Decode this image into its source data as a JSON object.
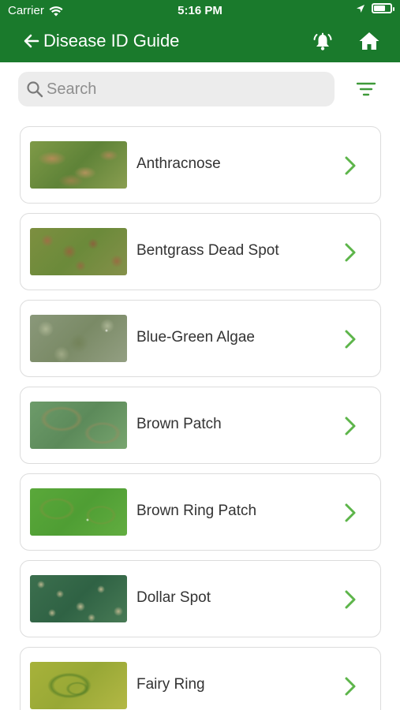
{
  "status_bar": {
    "carrier": "Carrier",
    "time": "5:16 PM"
  },
  "header": {
    "title": "Disease ID Guide"
  },
  "search": {
    "placeholder": "Search",
    "value": ""
  },
  "colors": {
    "brand_green": "#1a7a2c",
    "chevron_green": "#5db54a"
  },
  "diseases": [
    {
      "name": "Anthracnose",
      "thumbnail": "turf-anthracnose-photo"
    },
    {
      "name": "Bentgrass Dead Spot",
      "thumbnail": "turf-bentgrass-dead-spot-photo"
    },
    {
      "name": "Blue-Green Algae",
      "thumbnail": "turf-blue-green-algae-photo"
    },
    {
      "name": "Brown Patch",
      "thumbnail": "turf-brown-patch-photo"
    },
    {
      "name": "Brown Ring Patch",
      "thumbnail": "turf-brown-ring-patch-photo"
    },
    {
      "name": "Dollar Spot",
      "thumbnail": "turf-dollar-spot-photo"
    },
    {
      "name": "Fairy Ring",
      "thumbnail": "turf-fairy-ring-photo"
    }
  ]
}
